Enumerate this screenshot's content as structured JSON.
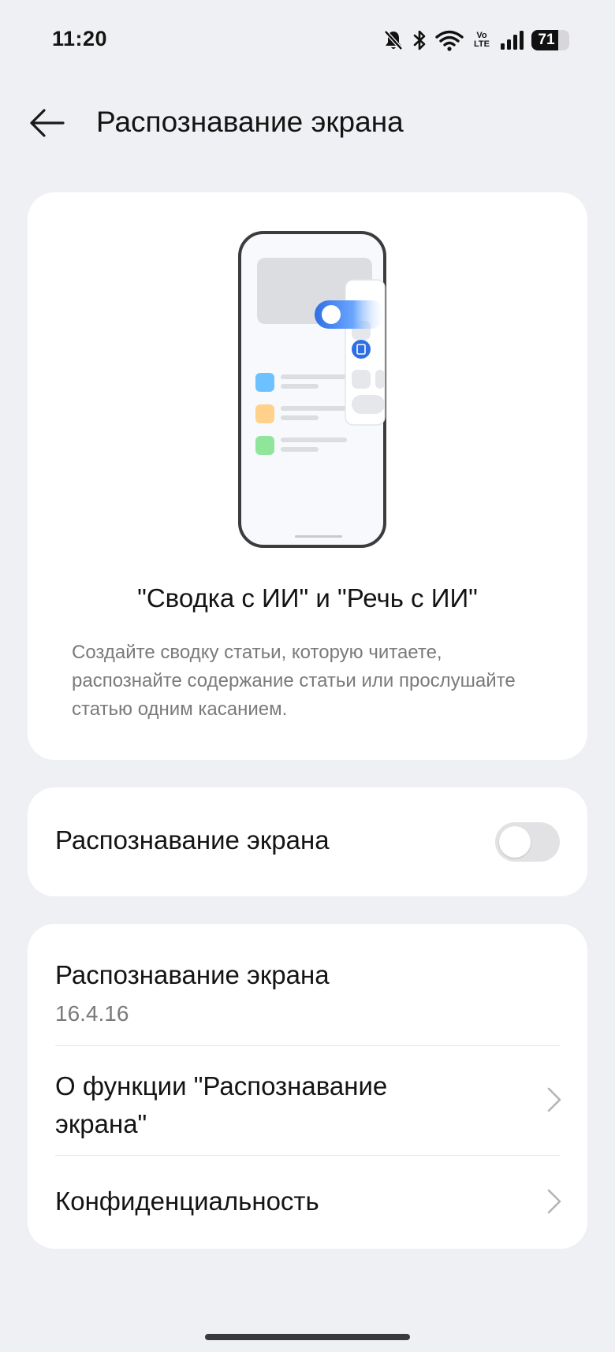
{
  "status_bar": {
    "time": "11:20",
    "icons": [
      "bell-off-icon",
      "bluetooth-icon",
      "wifi-icon",
      "volte-icon",
      "signal-icon",
      "battery-icon"
    ],
    "volte_top": "Vo",
    "volte_bottom": "LTE",
    "battery_level": "71",
    "battery_percent": 71
  },
  "header": {
    "back_icon": "arrow-left-icon",
    "title": "Распознавание экрана"
  },
  "hero": {
    "title": "\"Сводка с ИИ\" и \"Речь с ИИ\"",
    "description": "Создайте сводку статьи, которую читаете, распознайте содержание статьи или прослушайте статью одним касанием.",
    "illustration_colors": {
      "accent": "#2f6fe4",
      "blue_tile": "#6ec1ff",
      "orange_tile": "#ffd18a",
      "green_tile": "#8fe69a"
    }
  },
  "toggle": {
    "label": "Распознавание экрана",
    "state": "off"
  },
  "info": {
    "version_label": "Распознавание экрана",
    "version_value": "16.4.16",
    "about_label": "О функции \"Распознавание экрана\"",
    "privacy_label": "Конфиденциальность",
    "chevron_icon": "chevron-right-icon"
  },
  "colors": {
    "background": "#eff0f3",
    "card": "#ffffff",
    "text_primary": "#141414",
    "text_secondary": "#7a7a7d",
    "toggle_off": "#e2e2e4"
  }
}
